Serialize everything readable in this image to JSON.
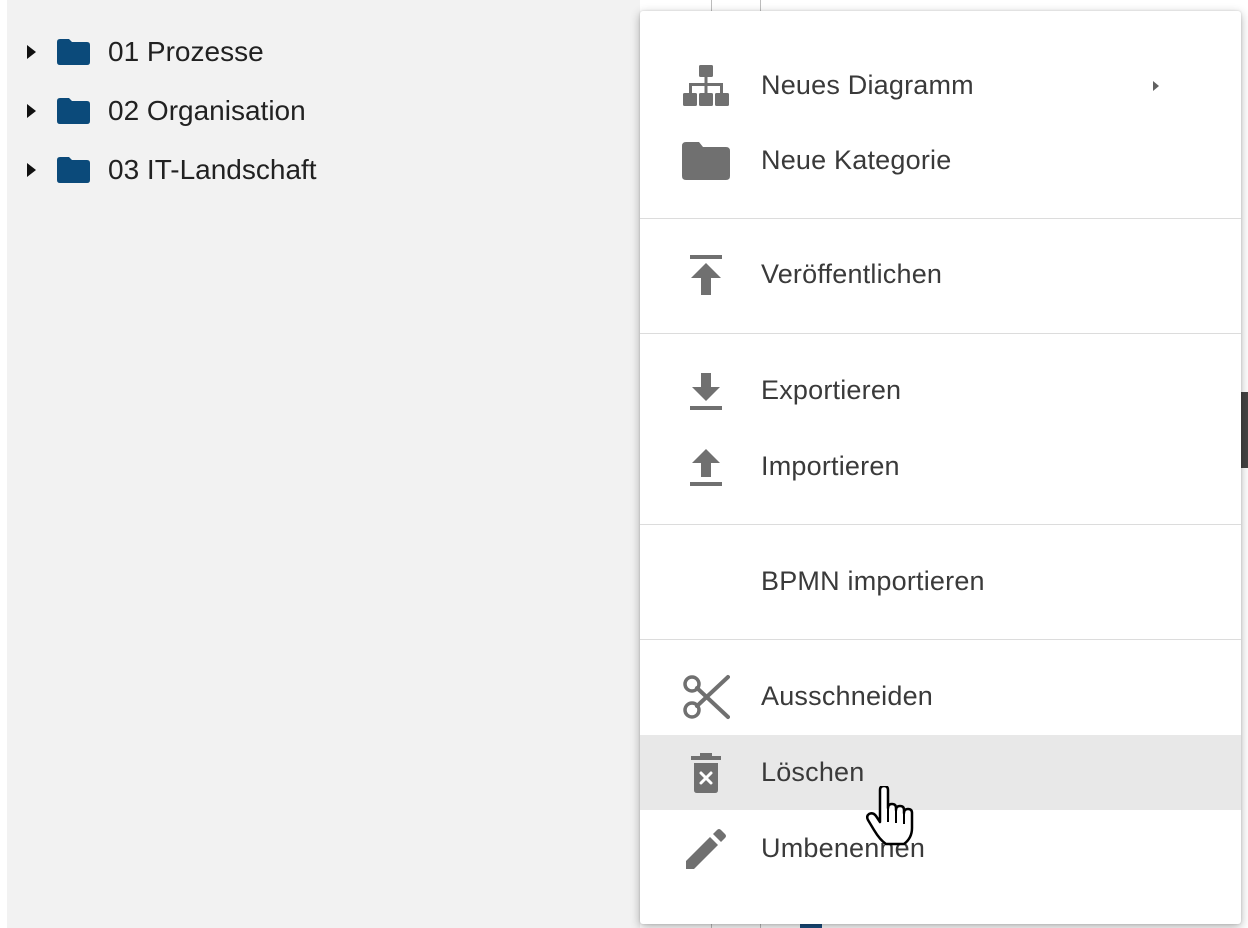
{
  "tree": {
    "items": [
      {
        "label": "01 Prozesse"
      },
      {
        "label": "02 Organisation"
      },
      {
        "label": "03 IT-Landschaft"
      }
    ],
    "folder_color": "#0b4a7a"
  },
  "context_menu": {
    "items": {
      "new_diagram": {
        "label": "Neues Diagramm",
        "icon": "sitemap-icon",
        "has_submenu": true
      },
      "new_category": {
        "label": "Neue Kategorie",
        "icon": "folder-icon"
      },
      "publish": {
        "label": "Veröffentlichen",
        "icon": "publish-icon"
      },
      "export": {
        "label": "Exportieren",
        "icon": "download-icon"
      },
      "import": {
        "label": "Importieren",
        "icon": "upload-icon"
      },
      "bpmn_import": {
        "label": "BPMN importieren"
      },
      "cut": {
        "label": "Ausschneiden",
        "icon": "scissors-icon"
      },
      "delete": {
        "label": "Löschen",
        "icon": "delete-icon",
        "hovered": true
      },
      "rename": {
        "label": "Umbenennen",
        "icon": "pencil-icon"
      }
    },
    "icon_color": "#707070",
    "hover_background": "#e8e8e8"
  }
}
